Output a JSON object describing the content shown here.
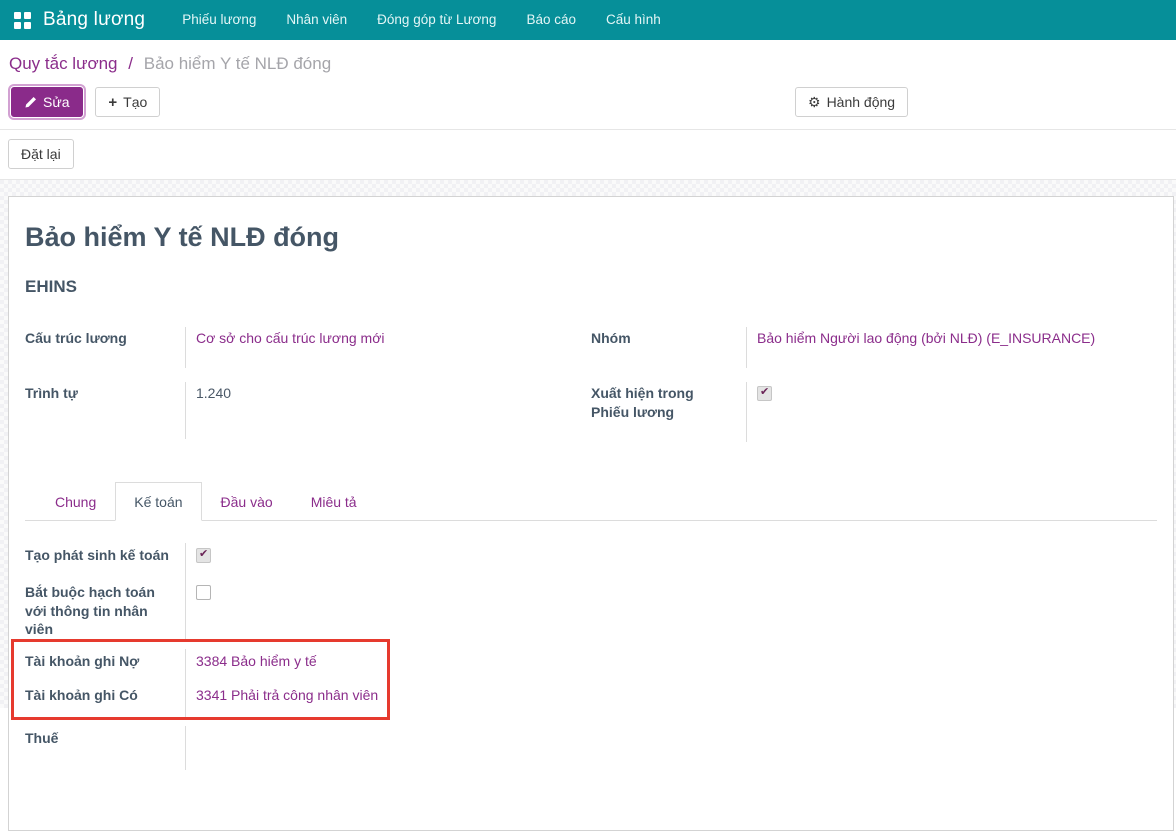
{
  "colors": {
    "topbar_teal": "#068f99",
    "primary_purple": "#8a2b8a",
    "link_purple": "#8b2d8b",
    "annotation_red": "#e63a2e"
  },
  "topbar": {
    "brand": "Bảng lương",
    "menu": [
      "Phiếu lương",
      "Nhân viên",
      "Đóng góp từ Lương",
      "Báo cáo",
      "Cấu hình"
    ]
  },
  "breadcrumb": {
    "parent": "Quy tắc lương",
    "separator": "/",
    "current": "Bảo hiểm Y tế NLĐ đóng"
  },
  "actions": {
    "edit": "Sửa",
    "create": "Tạo",
    "action_menu": "Hành động",
    "reset": "Đặt lại"
  },
  "record": {
    "title": "Bảo hiểm Y tế NLĐ đóng",
    "code": "EHINS",
    "fields": {
      "salary_structure": {
        "label": "Cấu trúc lương",
        "value": "Cơ sở cho cấu trúc lương mới"
      },
      "category": {
        "label": "Nhóm",
        "value": "Bảo hiểm Người lao động (bởi NLĐ) (E_INSURANCE)"
      },
      "sequence": {
        "label": "Trình tự",
        "value": "1.240"
      },
      "appears_on_payslip": {
        "label": "Xuất hiện trong Phiếu lương",
        "checked": true
      }
    },
    "tabs": [
      {
        "label": "Chung",
        "active": false
      },
      {
        "label": "Kế toán",
        "active": true
      },
      {
        "label": "Đầu vào",
        "active": false
      },
      {
        "label": "Miêu tả",
        "active": false
      }
    ],
    "accounting": {
      "generate_entries": {
        "label": "Tạo phát sinh kế toán",
        "checked": true
      },
      "force_employee_account": {
        "label": "Bắt buộc hạch toán với thông tin nhân viên",
        "checked": false
      },
      "debit_account": {
        "label": "Tài khoản ghi Nợ",
        "value": "3384 Bảo hiểm y tế"
      },
      "credit_account": {
        "label": "Tài khoản ghi Có",
        "value": "3341 Phải trả công nhân viên"
      },
      "tax": {
        "label": "Thuế",
        "value": ""
      }
    }
  }
}
